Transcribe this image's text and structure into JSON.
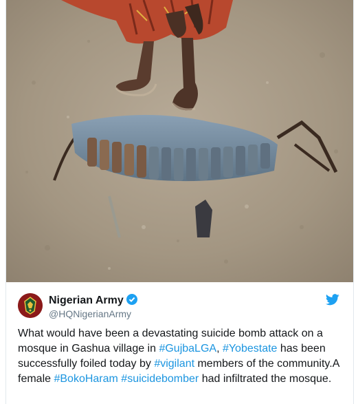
{
  "tweet": {
    "author_name": "Nigerian Army",
    "author_handle": "@HQNigerianArmy",
    "text_parts": [
      {
        "t": "What would have been a devastating suicide bomb attack on a mosque in Gashua village in ",
        "hash": false
      },
      {
        "t": "#GujbaLGA",
        "hash": true
      },
      {
        "t": ", ",
        "hash": false
      },
      {
        "t": "#Yobestate",
        "hash": true
      },
      {
        "t": " has been successfully foiled today by ",
        "hash": false
      },
      {
        "t": "#vigilant",
        "hash": true
      },
      {
        "t": " members of the community.A female ",
        "hash": false
      },
      {
        "t": "#BokoHaram",
        "hash": true
      },
      {
        "t": " ",
        "hash": false
      },
      {
        "t": "#suicidebomber",
        "hash": true
      },
      {
        "t": " had infiltrated the mosque.",
        "hash": false
      }
    ]
  },
  "icons": {
    "verified": "verified-badge-icon",
    "platform": "twitter-bird-icon",
    "avatar": "army-crest-avatar"
  },
  "colors": {
    "link": "#1b95e0",
    "verified": "#1da1f2",
    "text": "#14171a",
    "muted": "#657786"
  }
}
